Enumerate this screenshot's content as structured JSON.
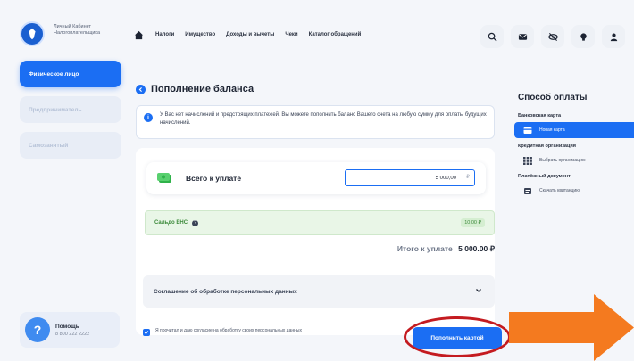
{
  "header": {
    "logo_text": "Личный Кабинет Налогоплательщика",
    "nav": [
      "Налоги",
      "Имущество",
      "Доходы и вычеты",
      "Чеки",
      "Каталог обращений"
    ]
  },
  "sidebar": {
    "items": [
      {
        "label": "Физическое лицо",
        "active": true
      },
      {
        "label": "Предприниматель",
        "active": false
      },
      {
        "label": "Самозанятый",
        "active": false
      }
    ],
    "help": {
      "title": "Помощь",
      "phone": "8 800 222 2222"
    }
  },
  "main": {
    "title": "Пополнение баланса",
    "info": "У Вас нет начислений и предстоящих платежей. Вы можете пополнить баланс Вашего счета на любую сумму для оплаты будущих начислений.",
    "sum_label": "Всего к уплате",
    "sum_value": "5 000,00",
    "currency": "₽",
    "saldo_label": "Сальдо ЕНС",
    "saldo_value": "10,00 ₽",
    "total_label": "Итого к уплате",
    "total_value": "5 000.00 ₽",
    "agreement_label": "Соглашение об обработке персональных данных",
    "consent_text": "Я прочитал и даю согласие на обработку своих персональных данных",
    "pay_button": "Пополнить картой"
  },
  "payment": {
    "title": "Способ оплаты",
    "groups": [
      {
        "label": "Банковская карта",
        "option": "Новая карта",
        "active": true
      },
      {
        "label": "Кредитная организация",
        "option": "Выбрать организацию",
        "active": false
      },
      {
        "label": "Платёжный документ",
        "option": "Скачать квитанцию",
        "active": false
      }
    ]
  },
  "colors": {
    "accent": "#1b6ef3",
    "saldo_bg": "#e9f6e7",
    "highlight": "#c41b20",
    "arrow": "#f47a1f"
  }
}
